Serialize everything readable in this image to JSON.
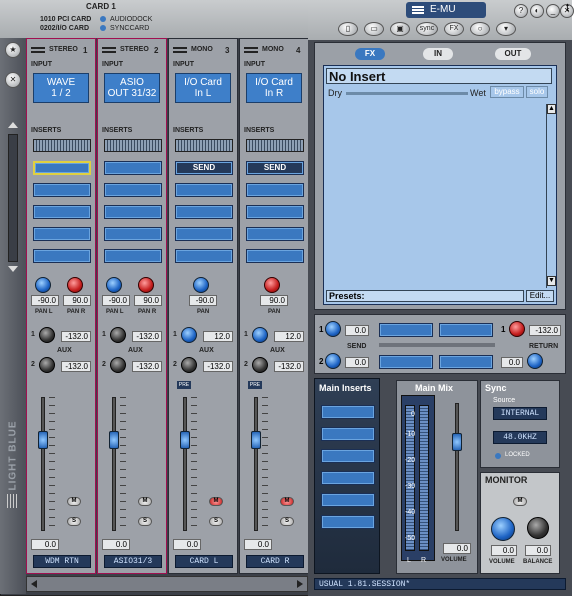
{
  "card_title": "CARD 1",
  "cards": [
    "1010 PCI CARD",
    "0202/I/O CARD"
  ],
  "docks": [
    "AUDIODOCK",
    "SYNCCARD"
  ],
  "app_title": "E-MU",
  "t_char": "t",
  "colors": {
    "accent": "#3a78c0",
    "frame": "#b0a24a"
  },
  "toolbar": {
    "sync": "sync",
    "fx": "FX"
  },
  "strips": [
    {
      "type": "STEREO",
      "num": "1",
      "input_line1": "WAVE",
      "input_line2": "1 / 2",
      "pan_l": "-90.0",
      "pan_r": "90.0",
      "aux1": "-132.0",
      "aux2": "-132.0",
      "fader": "0.0",
      "name": "WDM RTN",
      "pan_l_label": "PAN L",
      "pan_r_label": "PAN R"
    },
    {
      "type": "STEREO",
      "num": "2",
      "input_line1": "ASIO",
      "input_line2": "OUT 31/32",
      "pan_l": "-90.0",
      "pan_r": "90.0",
      "aux1": "-132.0",
      "aux2": "-132.0",
      "fader": "0.0",
      "name": "ASIO31/3",
      "pan_l_label": "PAN L",
      "pan_r_label": "PAN R"
    },
    {
      "type": "MONO",
      "num": "3",
      "input_line1": "I/O Card",
      "input_line2": "In L",
      "pan": "-90.0",
      "aux1": "12.0",
      "aux2": "-132.0",
      "fader": "0.0",
      "name": "CARD L",
      "pan_label": "PAN",
      "send": "SEND",
      "pre": "PRE"
    },
    {
      "type": "MONO",
      "num": "4",
      "input_line1": "I/O Card",
      "input_line2": "In R",
      "pan": "90.0",
      "aux1": "12.0",
      "aux2": "-132.0",
      "fader": "0.0",
      "name": "CARD R",
      "pan_label": "PAN",
      "send": "SEND",
      "pre": "PRE"
    }
  ],
  "labels": {
    "input": "INPUT",
    "inserts": "INSERTS",
    "aux": "AUX",
    "m": "M",
    "s": "S",
    "aux1": "1",
    "aux2": "2"
  },
  "side_logo": "LIGHT BLUE",
  "fx": {
    "tabs": [
      "FX",
      "IN",
      "OUT"
    ],
    "insert_title": "No Insert",
    "dry": "Dry",
    "wet": "Wet",
    "bypass": "bypass",
    "solo": "solo",
    "presets_label": "Presets:",
    "edit": "Edit..."
  },
  "sends": {
    "send_label": "SEND",
    "return_label": "RETURN",
    "send1": "0.0",
    "send2": "0.0",
    "return1": "-132.0",
    "return2": "0.0"
  },
  "main_inserts": {
    "title": "Main Inserts"
  },
  "main_mix": {
    "title": "Main Mix",
    "ticks": [
      "0",
      "-10",
      "-20",
      "-30",
      "-40",
      "-50"
    ],
    "l": "L",
    "r": "R",
    "volume_value": "0.0",
    "volume_label": "VOLUME"
  },
  "sync": {
    "title": "Sync",
    "source_label": "Source",
    "source": "INTERNAL",
    "rate": "48.0KHZ",
    "locked": "LOCKED"
  },
  "monitor": {
    "title": "MONITOR",
    "m": "M",
    "volume": "0.0",
    "balance": "0.0",
    "volume_label": "VOLUME",
    "balance_label": "BALANCE"
  },
  "session": "USUAL 1.81.SESSION*"
}
